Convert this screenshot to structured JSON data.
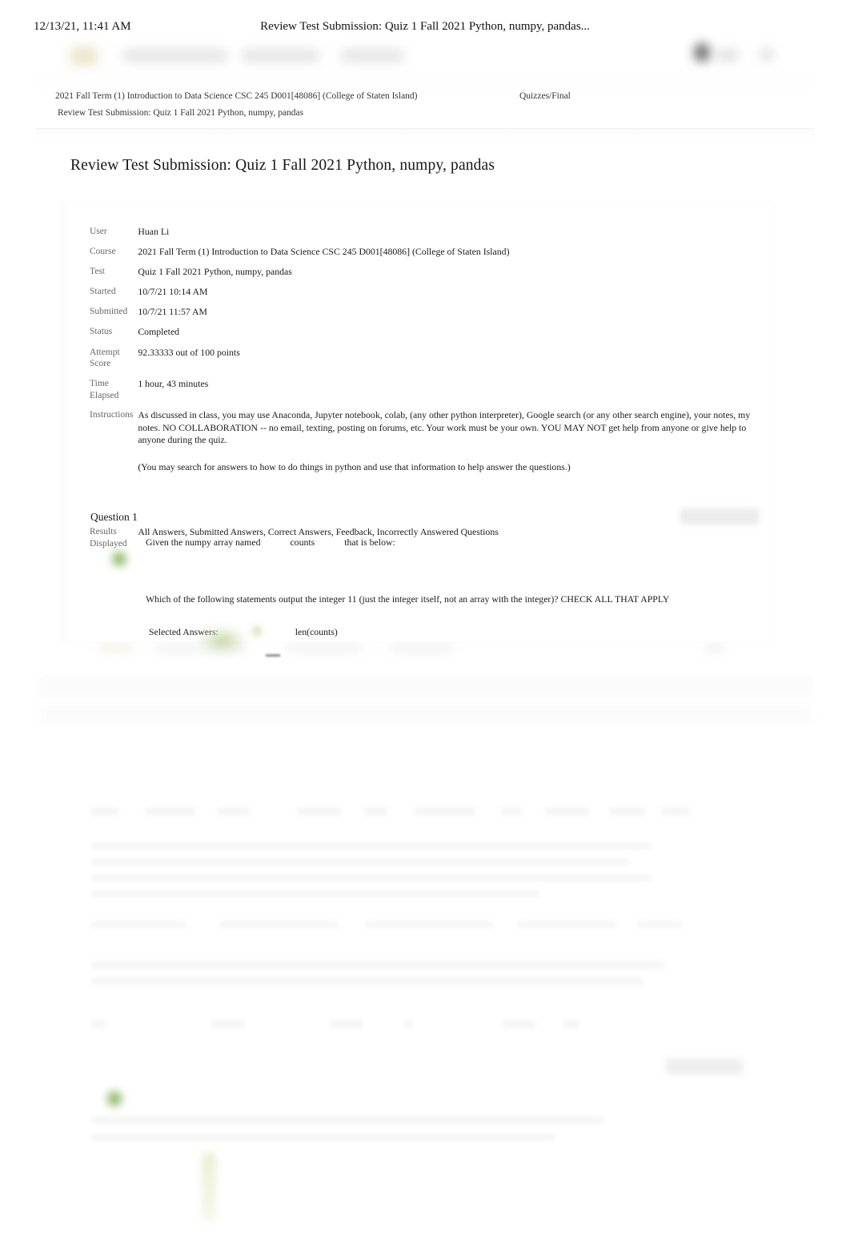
{
  "print_header": {
    "date": "12/13/21, 11:41 AM",
    "title": "Review Test Submission: Quiz 1 Fall 2021 Python, numpy, pandas..."
  },
  "breadcrumb": {
    "course": "2021 Fall Term (1) Introduction to Data Science CSC 245 D001[48086] (College of Staten Island)",
    "section": "Quizzes/Final",
    "current": "Review Test Submission: Quiz 1 Fall 2021 Python, numpy, pandas"
  },
  "page": {
    "title": "Review Test Submission: Quiz 1 Fall 2021 Python, numpy, pandas"
  },
  "info": {
    "labels": {
      "user": "User",
      "course": "Course",
      "test": "Test",
      "started": "Started",
      "submitted": "Submitted",
      "status": "Status",
      "attempt_score": "Attempt Score",
      "time_elapsed": "Time Elapsed",
      "instructions": "Instructions",
      "results_displayed": "Results Displayed"
    },
    "values": {
      "user": "Huan Li",
      "course": "2021 Fall Term (1) Introduction to Data Science CSC 245 D001[48086] (College of Staten Island)",
      "test": "Quiz 1 Fall 2021 Python, numpy, pandas",
      "started": "10/7/21 10:14 AM",
      "submitted": "10/7/21 11:57 AM",
      "status": "Completed",
      "attempt_score": "92.33333 out of 100 points",
      "time_elapsed": "1 hour, 43 minutes",
      "instructions_p1": "As discussed in class, you may use Anaconda, Jupyter notebook, colab, (any other python interpreter), Google search (or any other search engine), your notes, my notes. NO COLLABORATION -- no email, texting, posting on forums, etc. Your work must be your own. YOU MAY NOT get help from anyone or give help to anyone during the quiz.",
      "instructions_p2": "(You may search for answers to how to do things in python and use that information to help answer the questions.)",
      "results_displayed": "All Answers, Submitted Answers, Correct Answers, Feedback, Incorrectly Answered Questions"
    }
  },
  "question1": {
    "title": "Question 1",
    "prompt_prefix": "Given the numpy array named",
    "prompt_variable": "counts",
    "prompt_suffix": "that is below:",
    "check_instruction": "Which of the following statements output the integer 11 (just the integer itself, not an array with the integer)? CHECK ALL THAT APPLY",
    "selected_answers_label": "Selected Answers:",
    "selected_answer_1": "len(counts)"
  },
  "colors": {
    "correct_green": "#7fae5a",
    "text": "#1a1a1a",
    "label_gray": "#666666",
    "page_background": "#ffffff",
    "card_background": "#ffffff"
  }
}
